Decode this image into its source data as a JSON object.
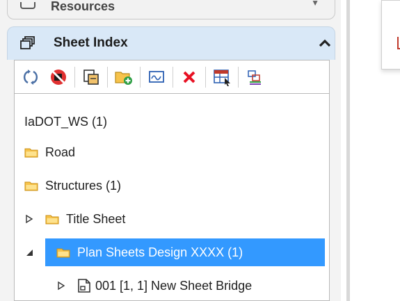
{
  "previous_section": {
    "label": "Resources"
  },
  "sheet_index": {
    "title": "Sheet Index",
    "toolbar": [
      {
        "name": "refresh-icon"
      },
      {
        "name": "disconnect-icon"
      },
      {
        "name": "add-sheet-icon"
      },
      {
        "name": "add-folder-icon"
      },
      {
        "name": "properties-icon"
      },
      {
        "name": "delete-icon"
      },
      {
        "name": "table-icon"
      },
      {
        "name": "settings-icon"
      }
    ],
    "tree": {
      "root": "IaDOT_WS (1)",
      "items": [
        {
          "label": "Road"
        },
        {
          "label": "Structures (1)"
        },
        {
          "label": "Title Sheet"
        },
        {
          "label": "Plan Sheets Design XXXX (1)",
          "selected": true
        },
        {
          "label": "001 [1, 1] New Sheet Bridge"
        }
      ]
    }
  },
  "colors": {
    "header_bg": "#d9e8f7",
    "selection": "#3399ff",
    "folder": "#f7c34b",
    "delete": "#e81123"
  }
}
